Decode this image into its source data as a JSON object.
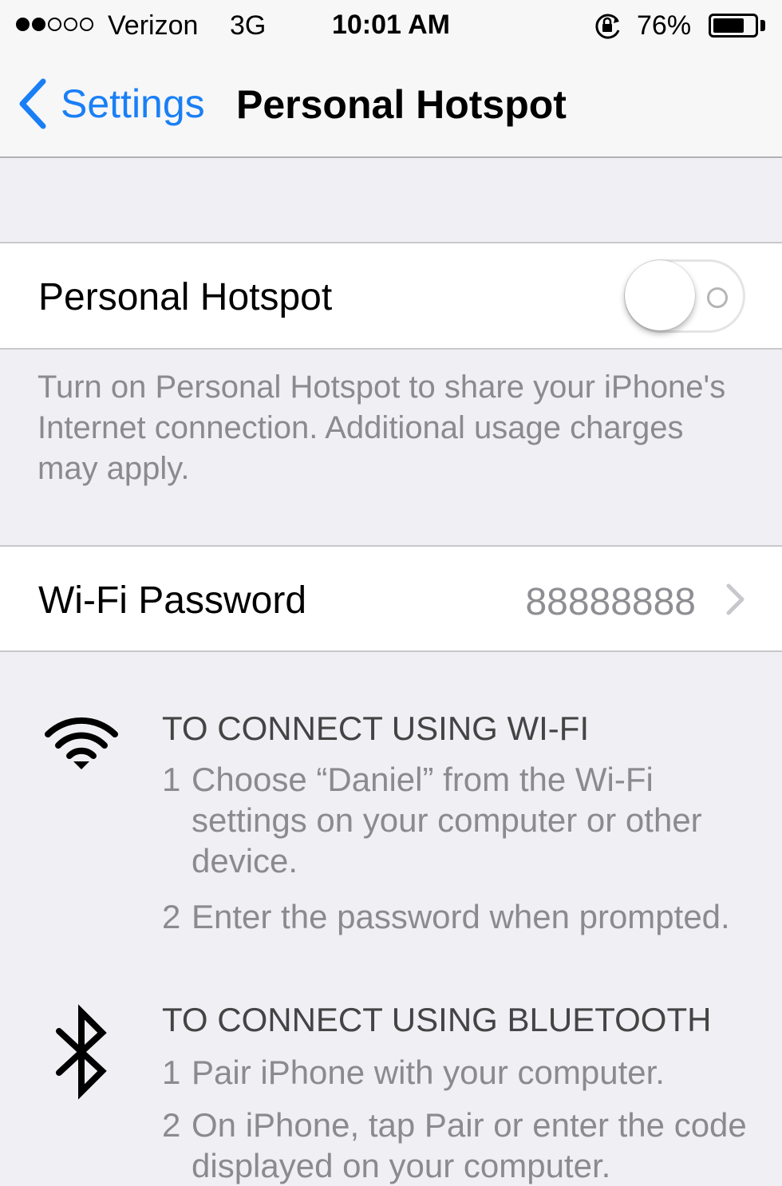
{
  "status_bar": {
    "signal_filled": 2,
    "signal_total": 5,
    "carrier": "Verizon",
    "network": "3G",
    "time": "10:01 AM",
    "battery": "76%",
    "battery_level": 0.76
  },
  "nav": {
    "back_label": "Settings",
    "title": "Personal Hotspot"
  },
  "hotspot": {
    "label": "Personal Hotspot",
    "enabled": false,
    "footer": "Turn on Personal Hotspot to share your iPhone's Internet connection. Additional usage charges may apply."
  },
  "wifi_password": {
    "label": "Wi-Fi Password",
    "value": "88888888"
  },
  "instructions": {
    "wifi": {
      "heading": "TO CONNECT USING WI-FI",
      "steps": [
        {
          "num": "1",
          "text": "Choose “Daniel” from the Wi-Fi settings on your computer or other device."
        },
        {
          "num": "2",
          "text": "Enter the password when prompted."
        }
      ]
    },
    "bluetooth": {
      "heading": "TO CONNECT USING BLUETOOTH",
      "steps": [
        {
          "num": "1",
          "text": "Pair iPhone with your computer."
        },
        {
          "num": "2",
          "text": "On iPhone, tap Pair or enter the code displayed on your computer."
        }
      ]
    }
  },
  "colors": {
    "accent": "#1a7ff5",
    "background": "#efeff4",
    "secondary_text": "#8a8a8f"
  },
  "icons": {
    "back": "chevron-left-icon",
    "lock": "orientation-lock-icon",
    "battery": "battery-icon",
    "disclosure": "chevron-right-icon",
    "wifi": "wifi-icon",
    "bluetooth": "bluetooth-icon"
  }
}
